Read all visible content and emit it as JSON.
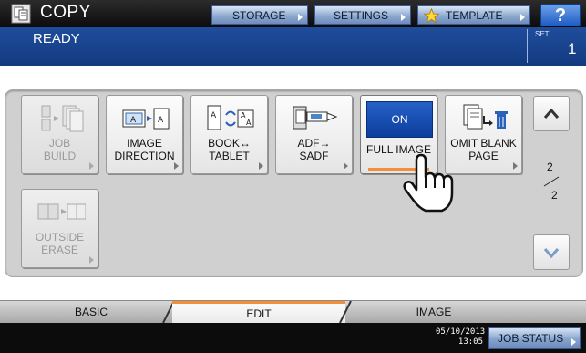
{
  "app": {
    "title": "COPY",
    "icon": "copy-app-icon"
  },
  "toolbar": {
    "storage_label": "STORAGE",
    "settings_label": "SETTINGS",
    "template_label": "TEMPLATE",
    "template_icon": "star-icon",
    "help_label": "?"
  },
  "status": {
    "text": "READY",
    "set_label": "SET",
    "set_value": "1"
  },
  "functions": [
    {
      "label": "JOB\nBUILD",
      "icon": "job-build-icon",
      "enabled": false
    },
    {
      "label": "IMAGE\nDIRECTION",
      "icon": "image-direction-icon",
      "enabled": true
    },
    {
      "label": "BOOK↔\nTABLET",
      "icon": "book-tablet-icon",
      "enabled": true
    },
    {
      "label": "ADF→\nSADF",
      "icon": "adf-sadf-icon",
      "enabled": true
    },
    {
      "label": "FULL IMAGE",
      "state": "ON",
      "enabled": true,
      "selected": true
    },
    {
      "label": "OMIT BLANK\nPAGE",
      "icon": "omit-blank-page-icon",
      "enabled": true
    },
    {
      "label": "OUTSIDE\nERASE",
      "icon": "outside-erase-icon",
      "enabled": false
    }
  ],
  "pager": {
    "current": "2",
    "total": "2"
  },
  "tabs": [
    {
      "label": "BASIC",
      "active": false
    },
    {
      "label": "EDIT",
      "active": true
    },
    {
      "label": "IMAGE",
      "active": false
    }
  ],
  "footer": {
    "date": "05/10/2013",
    "time": "13:05",
    "job_status_label": "JOB STATUS"
  },
  "colors": {
    "accent_orange": "#f0913a",
    "status_blue": "#1a4591",
    "on_blue": "#1450b4"
  }
}
